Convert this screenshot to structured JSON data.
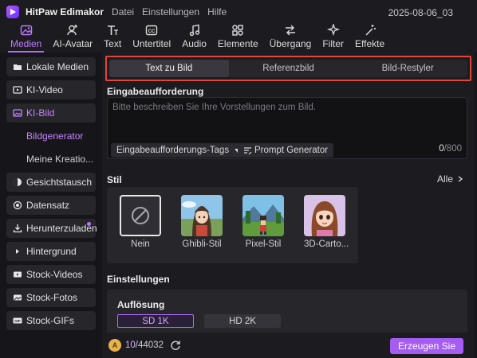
{
  "app": {
    "title": "HitPaw Edimakor",
    "menu": [
      "Datei",
      "Einstellungen",
      "Hilfe"
    ],
    "project_name": "2025-08-06_03"
  },
  "toolbar": [
    {
      "label": "Medien",
      "icon": "media-icon",
      "active": true
    },
    {
      "label": "AI-Avatar",
      "icon": "avatar-icon",
      "active": false
    },
    {
      "label": "Text",
      "icon": "text-icon",
      "active": false
    },
    {
      "label": "Untertitel",
      "icon": "subtitle-icon",
      "active": false
    },
    {
      "label": "Audio",
      "icon": "audio-icon",
      "active": false
    },
    {
      "label": "Elemente",
      "icon": "elements-icon",
      "active": false
    },
    {
      "label": "Übergang",
      "icon": "transition-icon",
      "active": false
    },
    {
      "label": "Filter",
      "icon": "filter-icon",
      "active": false
    },
    {
      "label": "Effekte",
      "icon": "effects-icon",
      "active": false
    }
  ],
  "sidebar": {
    "items": [
      {
        "label": "Lokale Medien",
        "icon": "folder-icon"
      },
      {
        "label": "KI-Video",
        "icon": "video-icon"
      },
      {
        "label": "KI-Bild",
        "icon": "image-icon",
        "active": true
      },
      {
        "label": "Bildgenerator",
        "sub": true,
        "active": true
      },
      {
        "label": "Meine Kreatio...",
        "sub": true
      },
      {
        "label": "Gesichtstausch",
        "icon": "face-swap-icon"
      },
      {
        "label": "Datensatz",
        "icon": "dataset-icon"
      },
      {
        "label": "Herunterzuladen",
        "icon": "download-icon",
        "badge": true
      },
      {
        "label": "Hintergrund",
        "icon": "caret-right-icon"
      },
      {
        "label": "Stock-Videos",
        "icon": "stock-video-icon"
      },
      {
        "label": "Stock-Fotos",
        "icon": "stock-photo-icon"
      },
      {
        "label": "Stock-GIFs",
        "icon": "gif-icon"
      }
    ]
  },
  "tabs": [
    {
      "label": "Text zu Bild",
      "active": true
    },
    {
      "label": "Referenzbild",
      "active": false
    },
    {
      "label": "Bild-Restyler",
      "active": false
    }
  ],
  "prompt": {
    "label": "Eingabeaufforderung",
    "placeholder": "Bitte beschreiben Sie Ihre Vorstellungen zum Bild.",
    "tags_label": "Eingabeaufforderungs-Tags",
    "generator_label": "Prompt Generator",
    "count_current": "0",
    "count_max": "/800"
  },
  "style": {
    "label": "Stil",
    "all_label": "Alle",
    "options": [
      {
        "label": "Nein",
        "selected": true
      },
      {
        "label": "Ghibli-Stil"
      },
      {
        "label": "Pixel-Stil"
      },
      {
        "label": "3D-Carto..."
      }
    ]
  },
  "settings": {
    "label": "Einstellungen",
    "resolution_label": "Auflösung",
    "resolutions": [
      {
        "label": "SD 1K",
        "active": true
      },
      {
        "label": "HD 2K",
        "active": false
      }
    ]
  },
  "footer": {
    "credits_used": "10",
    "credits_total": "/44032",
    "generate_label": "Erzeugen Sie"
  },
  "colors": {
    "accent": "#b469ff",
    "highlight_border": "#e0473c",
    "generate_button": "#a45cf2",
    "coin": "#e8b34c"
  }
}
